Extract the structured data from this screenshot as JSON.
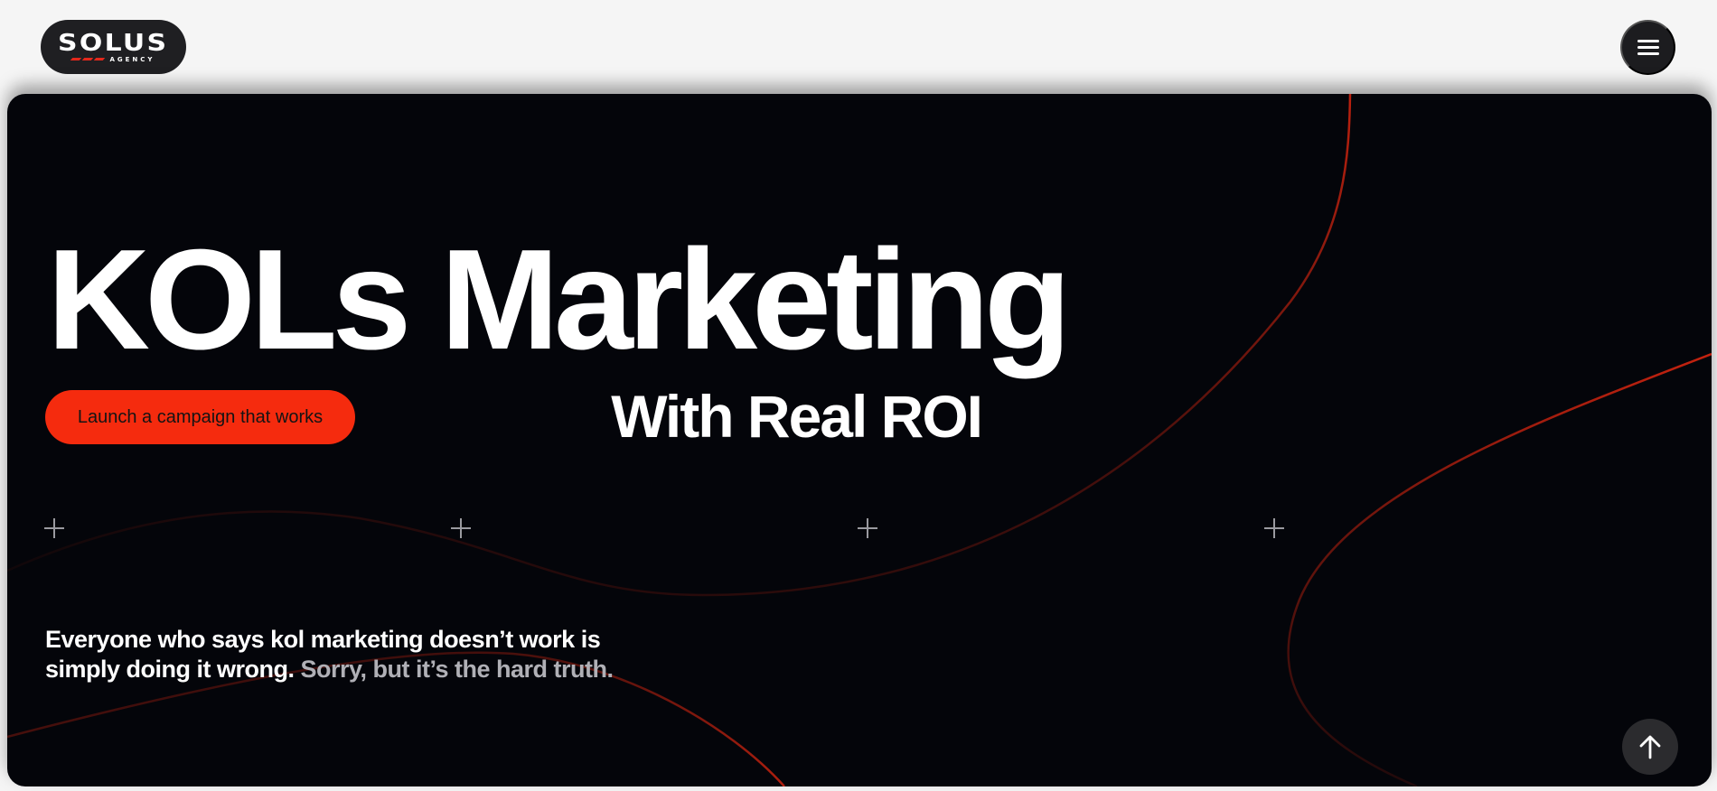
{
  "header": {
    "logo_text": "SOLUS",
    "logo_subtext": "AGENCY",
    "menu_icon": "hamburger-menu-icon"
  },
  "hero": {
    "title": "KOLs Marketing",
    "subtitle": "With Real ROI",
    "cta_label": "Launch a campaign that works",
    "tagline_main": "Everyone who says kol marketing doesn’t work is simply doing it wrong.",
    "tagline_muted": "Sorry, but it’s the hard truth.",
    "plus_icon": "plus-icon",
    "scroll_top_icon": "arrow-up-icon"
  },
  "colors": {
    "page_background": "#f5f5f5",
    "hero_background": "#04050a",
    "accent": "#f52b0e",
    "curve_red": "#c4220f",
    "logo_background": "#1f1f22",
    "muted_text": "#b0b0b6"
  }
}
